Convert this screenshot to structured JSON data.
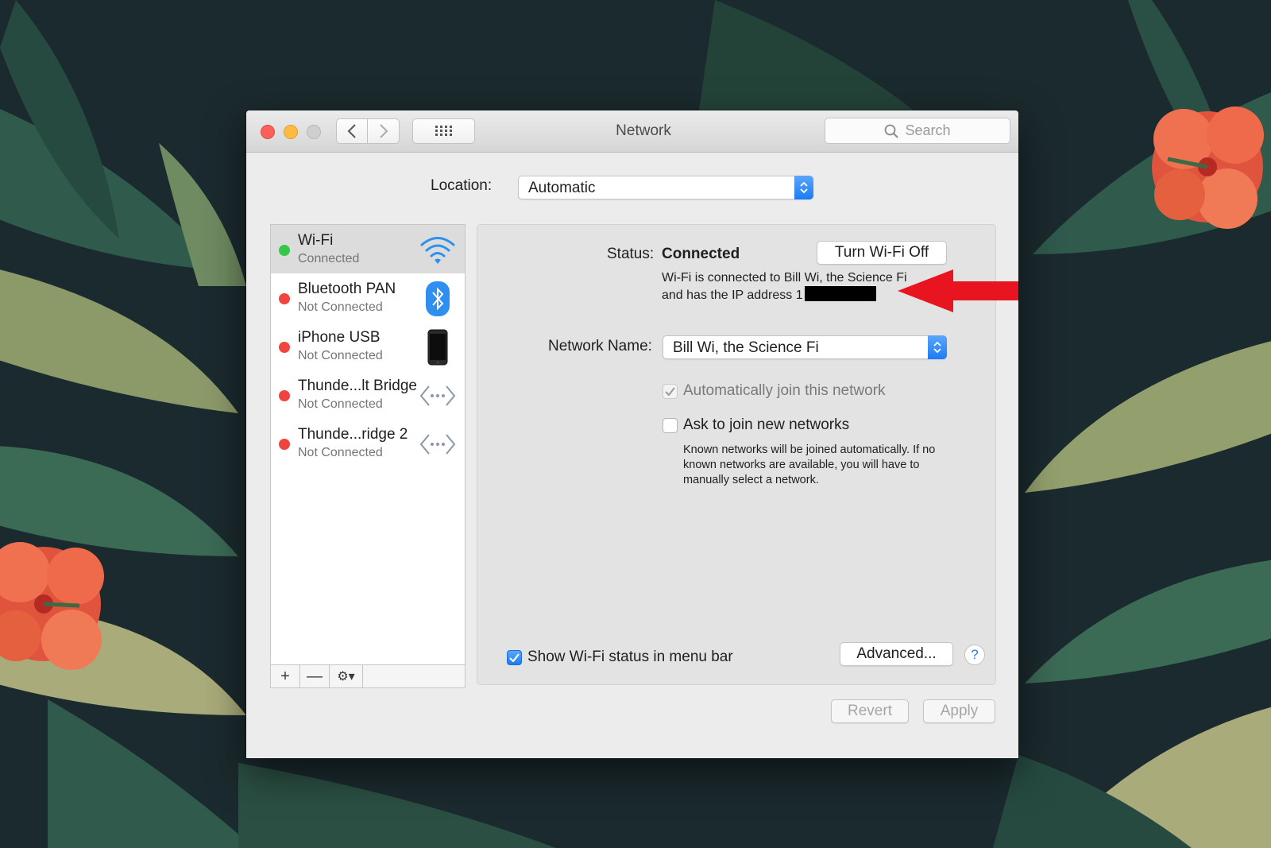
{
  "window": {
    "title": "Network",
    "search_placeholder": "Search"
  },
  "location": {
    "label": "Location:",
    "value": "Automatic"
  },
  "services": [
    {
      "name": "Wi-Fi",
      "status": "Connected",
      "status_color": "#34c748",
      "icon": "wifi-icon",
      "selected": true
    },
    {
      "name": "Bluetooth PAN",
      "status": "Not Connected",
      "status_color": "#f0443e",
      "icon": "bluetooth-icon",
      "selected": false
    },
    {
      "name": "iPhone USB",
      "status": "Not Connected",
      "status_color": "#f0443e",
      "icon": "iphone-icon",
      "selected": false
    },
    {
      "name": "Thunde...lt Bridge",
      "status": "Not Connected",
      "status_color": "#f0443e",
      "icon": "thunderbolt-bridge-icon",
      "selected": false
    },
    {
      "name": "Thunde...ridge 2",
      "status": "Not Connected",
      "status_color": "#f0443e",
      "icon": "thunderbolt-bridge-icon",
      "selected": false
    }
  ],
  "sidebar_toolbar": {
    "add": "+",
    "remove": "—",
    "actions_icon": "gear-icon"
  },
  "detail": {
    "status_label": "Status:",
    "status_value": "Connected",
    "turn_off_button": "Turn Wi-Fi Off",
    "status_desc_line1": "Wi-Fi is connected to Bill Wi, the Science Fi",
    "status_desc_line2": "and has the IP address 1",
    "network_name_label": "Network Name:",
    "network_name_value": "Bill Wi, the Science Fi",
    "auto_join_label": "Automatically join this network",
    "auto_join_checked": true,
    "ask_join_label": "Ask to join new networks",
    "ask_join_checked": false,
    "ask_join_help": "Known networks will be joined automatically. If no known networks are available, you will have to manually select a network.",
    "show_status_label": "Show Wi-Fi status in menu bar",
    "show_status_checked": true,
    "advanced_button": "Advanced...",
    "help_button": "?"
  },
  "footer": {
    "revert_button": "Revert",
    "apply_button": "Apply"
  },
  "colors": {
    "accent": "#1c7cf5",
    "annotation_arrow": "#e8141f",
    "wallpaper_bg": "#1b2a2e"
  }
}
